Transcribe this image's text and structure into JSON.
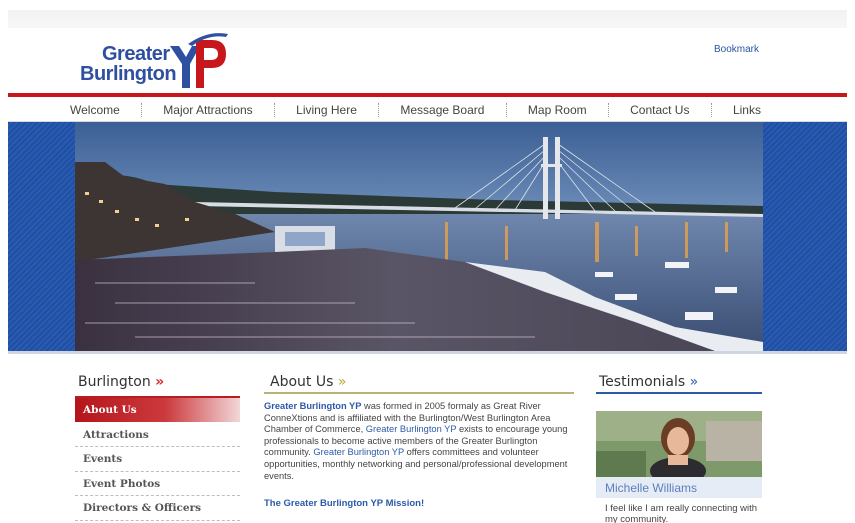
{
  "header": {
    "logo_line1": "Greater",
    "logo_line2": "Burlington",
    "logo_mark": "YP",
    "bookmark": "Bookmark"
  },
  "nav": {
    "items": [
      "Welcome",
      "Major Attractions",
      "Living Here",
      "Message Board",
      "Map Room",
      "Contact Us",
      "Links"
    ]
  },
  "left": {
    "title": "Burlington",
    "arrow": "»",
    "menu": [
      "About Us",
      "Attractions",
      "Events",
      "Event Photos",
      "Directors & Officers"
    ],
    "active_index": 0
  },
  "about": {
    "title": "About Us",
    "arrow": "»",
    "p1_name": "Greater Burlington YP",
    "p1_text": " was formed in 2005 formaly as Great River ConneXtions and is affiliated with the Burlington/West Burlington Area Chamber of Commerce, ",
    "p1_name2": "Greater Burlington YP",
    "p1_text2": " exists to encourage young professionals to become active members of the Greater Burlington community. ",
    "p1_name3": "Greater Burlington YP",
    "p1_text3": " offers committees and volunteer opportunities, monthly networking and personal/professional development events.",
    "mission": "The Greater Burlington YP  Mission!"
  },
  "testimonials": {
    "title": "Testimonials",
    "arrow": "»",
    "name": "Michelle Williams",
    "quote": "I feel like I am really connecting with my community."
  },
  "colors": {
    "brand_blue": "#2c5aa8",
    "brand_red": "#c8161d",
    "banner_blue": "#1f4fa3"
  },
  "icons": [
    "logo-mark-icon"
  ]
}
